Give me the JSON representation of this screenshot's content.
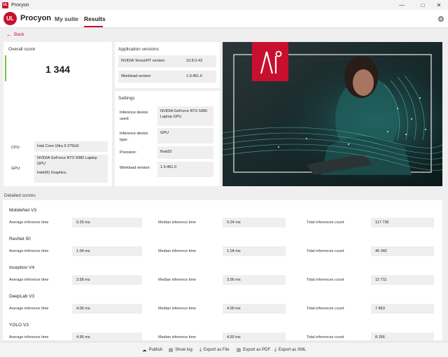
{
  "window": {
    "title": "Procyon"
  },
  "nav": {
    "brand": "Procyon",
    "my_suite": "My suite",
    "results": "Results"
  },
  "back_label": "Back",
  "overall": {
    "title": "Overall score",
    "score": "1 344",
    "cpu_label": "CPU:",
    "cpu_value": "Intel Core Ultra 9 275HX",
    "gpu_label": "GPU:",
    "gpu_value_1": "NVIDIA GeForce RTX 5080 Laptop GPU",
    "gpu_value_2": "Intel(R) Graphics"
  },
  "versions": {
    "title": "Application versions",
    "tensorrt_label": "NVIDIA TensorRT version",
    "tensorrt_value": "10.8.0.43",
    "workload_label": "Workload version",
    "workload_value": "1.9.461.0"
  },
  "settings": {
    "title": "Settings",
    "device_label": "Inference device used:",
    "device_value": "NVIDIA GeForce RTX 5080 Laptop GPU",
    "type_label": "Inference device type:",
    "type_value": "GPU",
    "precision_label": "Precision:",
    "precision_value": "float32",
    "workload_label": "Workload version:",
    "workload_value": "1.9.461.0"
  },
  "hero": {
    "brand_mark": "AI"
  },
  "detailed": {
    "title": "Detailed scores",
    "avg_label": "Average inference time",
    "median_label": "Median inference time",
    "total_label": "Total inferences count",
    "rows": [
      {
        "name": "MobileNet V3",
        "avg": "0.25 ms",
        "median": "0.24 ms",
        "total": "117 736"
      },
      {
        "name": "ResNet 50",
        "avg": "1.04 ms",
        "median": "1.04 ms",
        "total": "45 342"
      },
      {
        "name": "Inception V4",
        "avg": "3.58 ms",
        "median": "3.56 ms",
        "total": "12 711"
      },
      {
        "name": "DeepLab V3",
        "avg": "4.06 ms",
        "median": "4.00 ms",
        "total": "7 863"
      },
      {
        "name": "YOLO V3",
        "avg": "4.95 ms",
        "median": "4.93 ms",
        "total": "8 256"
      }
    ]
  },
  "footer": {
    "publish": "Publish",
    "show_log": "Show log",
    "export_file": "Export as File",
    "export_pdf": "Export as PDF",
    "export_xml": "Export as XML"
  },
  "colors": {
    "accent": "#c8102e",
    "score_bar": "#7ac143",
    "hero_teal": "#1f6d6b"
  }
}
